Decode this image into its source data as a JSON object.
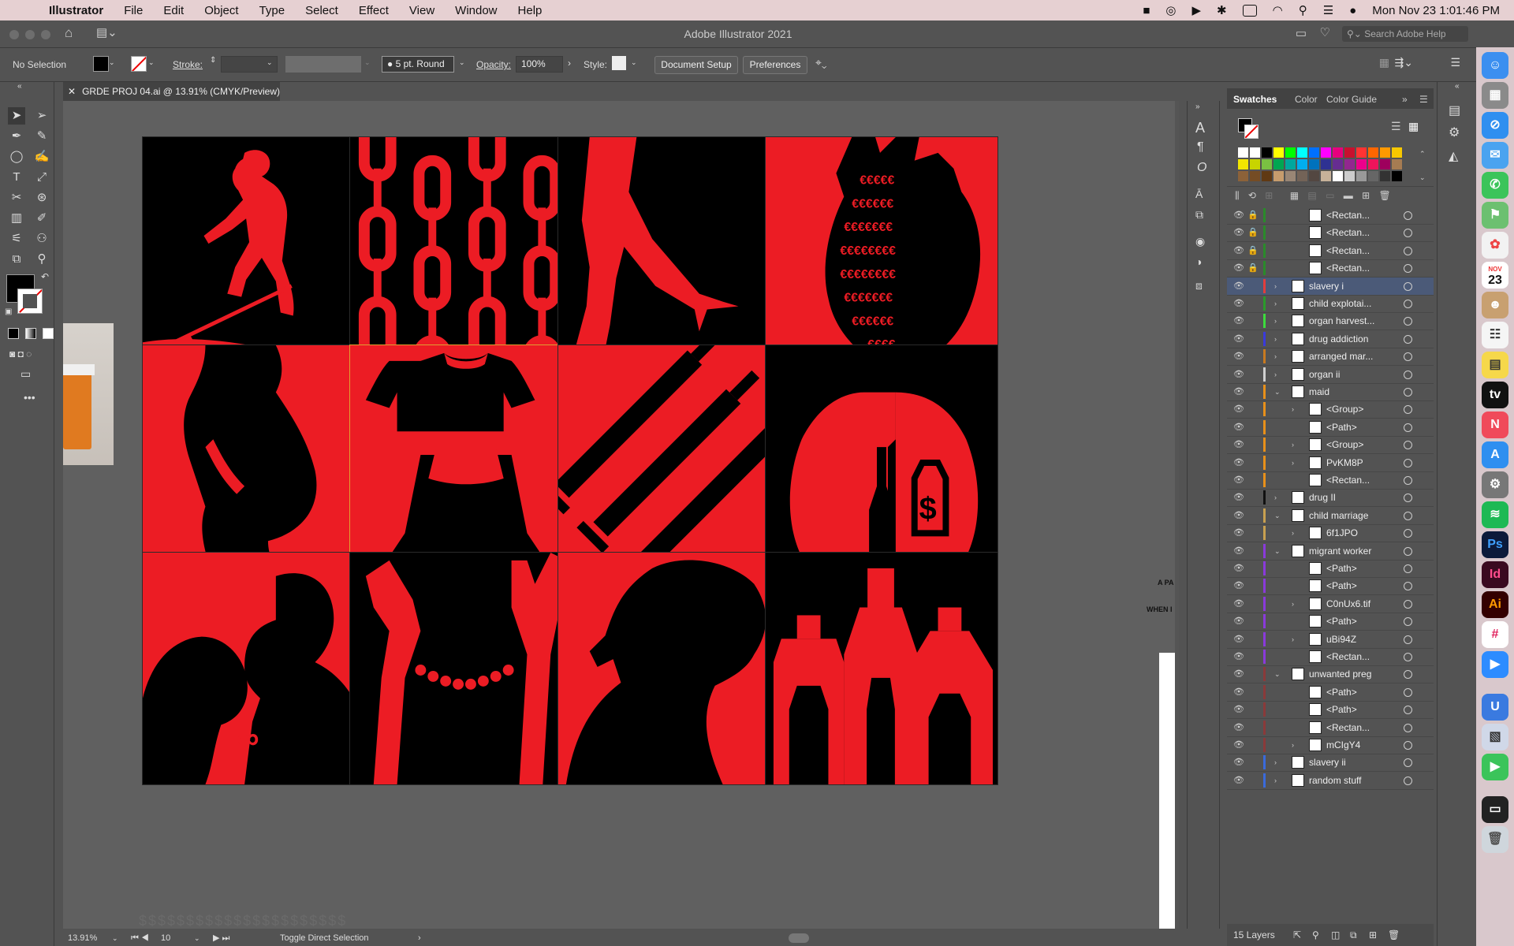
{
  "menubar": {
    "app": "Illustrator",
    "items": [
      "File",
      "Edit",
      "Object",
      "Type",
      "Select",
      "Effect",
      "View",
      "Window",
      "Help"
    ],
    "clock": "Mon Nov 23  1:01:46 PM"
  },
  "titlebar": {
    "title": "Adobe Illustrator 2021",
    "search_placeholder": "Search Adobe Help"
  },
  "controlbar": {
    "selection": "No Selection",
    "stroke_label": "Stroke:",
    "brush": "5 pt. Round",
    "opacity_label": "Opacity:",
    "opacity_value": "100%",
    "style_label": "Style:",
    "document_setup": "Document Setup",
    "preferences": "Preferences"
  },
  "document": {
    "tab": "GRDE PROJ 04.ai @ 13.91% (CMYK/Preview)",
    "side_text_1": "A PA",
    "side_text_2": "WHEN I",
    "bottom_text": "$$$$$$$$$$$$$$$$$$$$$$"
  },
  "tiles": [
    {
      "name": "slavery-farmer",
      "bg": "black"
    },
    {
      "name": "chains",
      "bg": "black"
    },
    {
      "name": "legs-heels",
      "bg": "black"
    },
    {
      "name": "heart-euro",
      "bg": "red"
    },
    {
      "name": "pregnant",
      "bg": "red"
    },
    {
      "name": "maid-dress",
      "bg": "red"
    },
    {
      "name": "syringes",
      "bg": "red"
    },
    {
      "name": "lungs-tag",
      "bg": "black"
    },
    {
      "name": "couple",
      "bg": "red"
    },
    {
      "name": "handcuffed-hands",
      "bg": "black"
    },
    {
      "name": "head-profile",
      "bg": "red"
    },
    {
      "name": "bottles",
      "bg": "black"
    }
  ],
  "statusbar": {
    "zoom": "13.91%",
    "artboard": "10",
    "tool_hint": "Toggle Direct Selection"
  },
  "panel": {
    "tabs": [
      "Swatches",
      "Color",
      "Color Guide"
    ],
    "swatch_colors": [
      "#ffffff",
      "#ffffff",
      "#000000",
      "#ffff00",
      "#00ff00",
      "#00ffff",
      "#0070ff",
      "#ff00ff",
      "#e6007e",
      "#c8102e",
      "#ff3333",
      "#ff6600",
      "#ff9900",
      "#f7c800",
      "#f2e600",
      "#c8d400",
      "#7ac142",
      "#00a651",
      "#00a79d",
      "#00aeef",
      "#0072bc",
      "#2e3192",
      "#662d91",
      "#92278f",
      "#ec008c",
      "#ed145b",
      "#9e005d",
      "#a67c52",
      "#8c6239",
      "#754c24",
      "#603913",
      "#c69c6d",
      "#998675",
      "#736357",
      "#534741",
      "#c7b299",
      "#ffffff",
      "#cccccc",
      "#999999",
      "#666666",
      "#333333",
      "#000000"
    ],
    "layers_count": "15 Layers",
    "layers": [
      {
        "name": "<Rectan...",
        "depth": 2,
        "locked": true,
        "expand": "",
        "color": "#2a8a2a"
      },
      {
        "name": "<Rectan...",
        "depth": 2,
        "locked": true,
        "expand": "",
        "color": "#2a8a2a"
      },
      {
        "name": "<Rectan...",
        "depth": 2,
        "locked": true,
        "expand": "",
        "color": "#2a8a2a"
      },
      {
        "name": "<Rectan...",
        "depth": 2,
        "locked": true,
        "expand": "",
        "color": "#2a8a2a"
      },
      {
        "name": "slavery i",
        "depth": 1,
        "locked": false,
        "expand": "›",
        "color": "#e23d3d",
        "selected": true
      },
      {
        "name": "child explotai...",
        "depth": 1,
        "locked": false,
        "expand": "›",
        "color": "#2a9a2a"
      },
      {
        "name": "organ harvest...",
        "depth": 1,
        "locked": false,
        "expand": "›",
        "color": "#3ddb3d"
      },
      {
        "name": "drug addiction",
        "depth": 1,
        "locked": false,
        "expand": "›",
        "color": "#3a3adb"
      },
      {
        "name": "arranged mar...",
        "depth": 1,
        "locked": false,
        "expand": "›",
        "color": "#c87a20"
      },
      {
        "name": "organ ii",
        "depth": 1,
        "locked": false,
        "expand": "›",
        "color": "#d0d0d0"
      },
      {
        "name": "maid",
        "depth": 1,
        "locked": false,
        "expand": "⌄",
        "color": "#e8901a"
      },
      {
        "name": "<Group>",
        "depth": 2,
        "locked": false,
        "expand": "›",
        "color": "#e8901a"
      },
      {
        "name": "<Path>",
        "depth": 2,
        "locked": false,
        "expand": "",
        "color": "#e8901a"
      },
      {
        "name": "<Group>",
        "depth": 2,
        "locked": false,
        "expand": "›",
        "color": "#e8901a"
      },
      {
        "name": "PvKM8P",
        "depth": 2,
        "locked": false,
        "expand": "›",
        "color": "#e8901a"
      },
      {
        "name": "<Rectan...",
        "depth": 2,
        "locked": false,
        "expand": "",
        "color": "#e8901a"
      },
      {
        "name": "drug II",
        "depth": 1,
        "locked": false,
        "expand": "›",
        "color": "#111111"
      },
      {
        "name": "child marriage",
        "depth": 1,
        "locked": false,
        "expand": "⌄",
        "color": "#c8a050"
      },
      {
        "name": "6f1JPO",
        "depth": 2,
        "locked": false,
        "expand": "›",
        "color": "#c8a050"
      },
      {
        "name": "migrant worker",
        "depth": 1,
        "locked": false,
        "expand": "⌄",
        "color": "#8a3adb"
      },
      {
        "name": "<Path>",
        "depth": 2,
        "locked": false,
        "expand": "",
        "color": "#8a3adb"
      },
      {
        "name": "<Path>",
        "depth": 2,
        "locked": false,
        "expand": "",
        "color": "#8a3adb"
      },
      {
        "name": "C0nUx6.tif",
        "depth": 2,
        "locked": false,
        "expand": "›",
        "color": "#8a3adb"
      },
      {
        "name": "<Path>",
        "depth": 2,
        "locked": false,
        "expand": "",
        "color": "#8a3adb"
      },
      {
        "name": "uBi94Z",
        "depth": 2,
        "locked": false,
        "expand": "›",
        "color": "#8a3adb"
      },
      {
        "name": "<Rectan...",
        "depth": 2,
        "locked": false,
        "expand": "",
        "color": "#8a3adb"
      },
      {
        "name": "unwanted preg",
        "depth": 1,
        "locked": false,
        "expand": "⌄",
        "color": "#8a3a3a"
      },
      {
        "name": "<Path>",
        "depth": 2,
        "locked": false,
        "expand": "",
        "color": "#8a3a3a"
      },
      {
        "name": "<Path>",
        "depth": 2,
        "locked": false,
        "expand": "",
        "color": "#8a3a3a"
      },
      {
        "name": "<Rectan...",
        "depth": 2,
        "locked": false,
        "expand": "",
        "color": "#8a3a3a"
      },
      {
        "name": "mCIgY4",
        "depth": 2,
        "locked": false,
        "expand": "›",
        "color": "#8a3a3a"
      },
      {
        "name": "slavery ii",
        "depth": 1,
        "locked": false,
        "expand": "›",
        "color": "#3a6adb"
      },
      {
        "name": "random stuff",
        "depth": 1,
        "locked": false,
        "expand": "›",
        "color": "#3a6adb"
      }
    ]
  },
  "dock": {
    "calendar_month": "NOV",
    "calendar_day": "23",
    "items": [
      "Finder",
      "Launchpad",
      "Safari",
      "Mail",
      "Messages",
      "Maps",
      "Photos",
      "Calendar",
      "Contacts",
      "Reminders",
      "Notes",
      "TV",
      "News",
      "App Store",
      "System Preferences",
      "Spotify",
      "Ps",
      "Id",
      "Ai",
      "Slack",
      "Zoom",
      "U",
      "Preview",
      "FaceTime",
      "Screenshot",
      "Trash"
    ]
  }
}
